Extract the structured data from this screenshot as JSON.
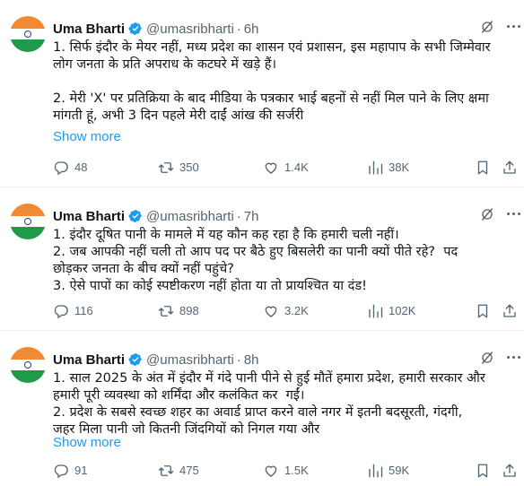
{
  "tweets": [
    {
      "author_name": "Uma Bharti",
      "handle": "@umasribharti",
      "time": "6h",
      "text_lines": [
        "1. सिर्फ इंदौर के मेयर नहीं, मध्य प्रदेश का शासन एवं प्रशासन, इस महापाप के सभी जिम्मेवार",
        "लोग जनता के प्रति अपराध के कटघरे में खड़े हैं।",
        "",
        "2. मेरी 'X' पर प्रतिक्रिया के बाद मीडिया के पत्रकार भाई बहनों से नहीं मिल पाने के लिए क्षमा",
        "मांगती हूं, अभी 3 दिन पहले मेरी दाईं आंख की सर्जरी"
      ],
      "show_more": "Show more",
      "replies": "48",
      "reposts": "350",
      "likes": "1.4K",
      "views": "38K"
    },
    {
      "author_name": "Uma Bharti",
      "handle": "@umasribharti",
      "time": "7h",
      "text_lines": [
        "1. इंदौर दूषित पानी के मामले में यह कौन कह रहा है कि हमारी चली नहीं।",
        "2. जब आपकी नहीं चली तो आप पद पर बैठे हुए बिसलेरी का पानी क्यों पीते रहे?  पद",
        "छोड़कर जनता के बीच क्यों नहीं पहुंचे?",
        "3. ऐसे पापों का कोई स्पष्टीकरण नहीं होता या तो प्रायश्चित या दंड!"
      ],
      "show_more": "",
      "replies": "116",
      "reposts": "898",
      "likes": "3.2K",
      "views": "102K"
    },
    {
      "author_name": "Uma Bharti",
      "handle": "@umasribharti",
      "time": "8h",
      "text_lines": [
        "1. साल 2025 के अंत में इंदौर में गंदे पानी पीने से हुई मौतें हमारा प्रदेश, हमारी सरकार और",
        "हमारी पूरी व्यवस्था को शर्मिंदा और कलंकित कर  गईं।",
        "2. प्रदेश के सबसे स्वच्छ शहर का अवार्ड प्राप्त करने वाले नगर में इतनी बदसूरती, गंदगी,",
        "जहर मिला पानी जो कितनी जिंदगियों को निगल गया और"
      ],
      "show_more": "Show more",
      "replies": "91",
      "reposts": "475",
      "likes": "1.5K",
      "views": "59K"
    }
  ],
  "colors": {
    "accent": "#1d9bf0",
    "muted": "#536471",
    "text": "#0f1419",
    "flag_saffron": "#f08a35",
    "flag_green": "#1e9b4a"
  },
  "icons": {
    "verified": "verified-badge-icon",
    "grok": "grok-icon",
    "more": "more-options-icon",
    "reply": "reply-icon",
    "repost": "repost-icon",
    "like": "like-icon",
    "views": "views-icon",
    "bookmark": "bookmark-icon",
    "share": "share-icon"
  }
}
